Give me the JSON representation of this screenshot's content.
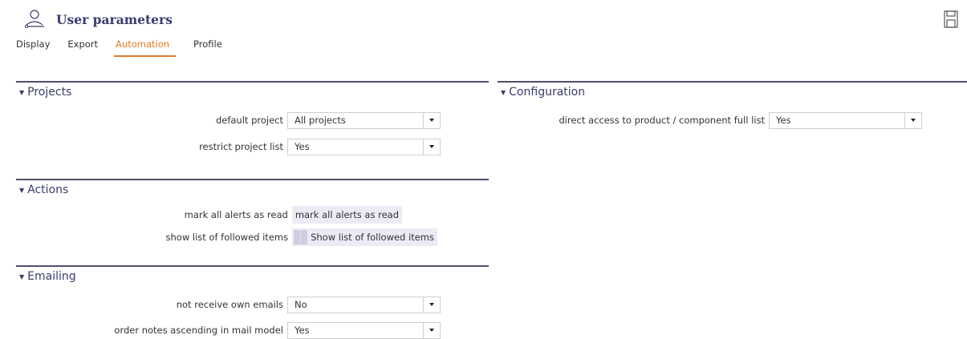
{
  "header": {
    "title": "User parameters",
    "user_icon": "user-icon",
    "save_icon": "save-icon"
  },
  "tabs": [
    {
      "label": "Display",
      "active": false
    },
    {
      "label": "Export",
      "active": false
    },
    {
      "label": "Automation",
      "active": true
    },
    {
      "label": "Profile",
      "active": false
    }
  ],
  "colors": {
    "accent": "#e07b2a",
    "title": "#3b3b6e",
    "section_border": "#4e4e6e",
    "button_bg": "#ecebf5"
  },
  "projects": {
    "title": "Projects",
    "default_project": {
      "label": "default project",
      "value": "All projects"
    },
    "restrict_project_list": {
      "label": "restrict project list",
      "value": "Yes"
    }
  },
  "actions": {
    "title": "Actions",
    "mark_alerts": {
      "label": "mark all alerts as read",
      "button": "mark all alerts as read"
    },
    "followed": {
      "label": "show list of followed items",
      "button": "Show list of followed items"
    }
  },
  "emailing": {
    "title": "Emailing",
    "own_emails": {
      "label": "not receive own emails",
      "value": "No"
    },
    "notes_order": {
      "label": "order notes ascending in mail model",
      "value": "Yes"
    }
  },
  "configuration": {
    "title": "Configuration",
    "direct_access": {
      "label": "direct access to product / component full list",
      "value": "Yes"
    }
  }
}
